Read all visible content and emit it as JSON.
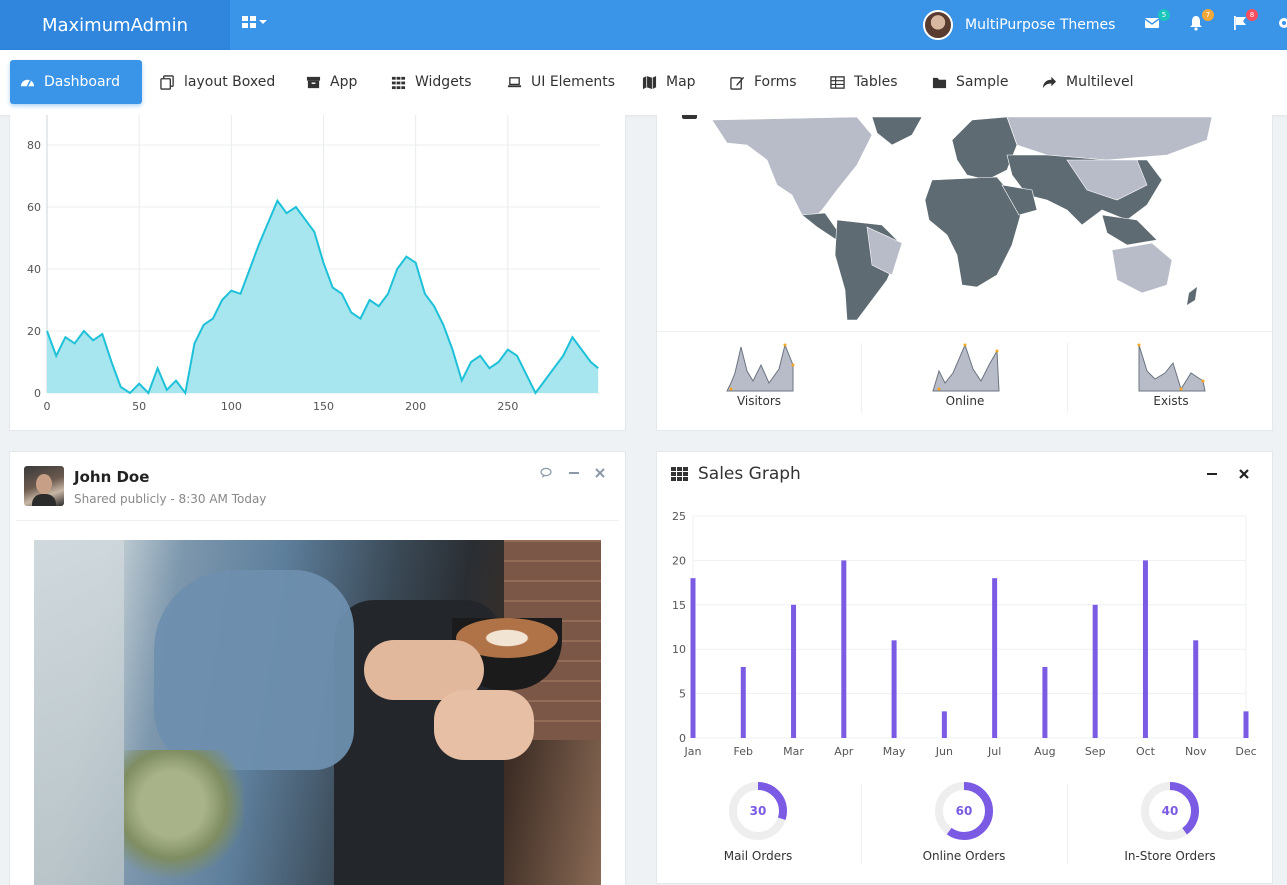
{
  "brand": "MaximumAdmin",
  "user": {
    "name": "MultiPurpose Themes"
  },
  "badges": {
    "mail": "5",
    "bell": "7",
    "flag": "8"
  },
  "colors": {
    "primary": "#3a94e8",
    "brand_bg": "#2f86dc",
    "area": "#1fc1d8",
    "area_fill": "#a8e6ef",
    "bar": "#7b5be4",
    "map_dark": "#5f6b73",
    "map_light": "#b8bcc9",
    "badge_mail": "#1bc5bd",
    "badge_bell": "#f2a93b",
    "badge_flag": "#f64e60"
  },
  "nav": [
    {
      "label": "Dashboard",
      "icon": "dashboard-icon"
    },
    {
      "label": "layout Boxed",
      "icon": "copy-icon"
    },
    {
      "label": "App",
      "icon": "archive-icon"
    },
    {
      "label": "Widgets",
      "icon": "grid-icon"
    },
    {
      "label": "UI Elements",
      "icon": "laptop-icon"
    },
    {
      "label": "Map",
      "icon": "map-icon"
    },
    {
      "label": "Forms",
      "icon": "edit-icon"
    },
    {
      "label": "Tables",
      "icon": "table-icon"
    },
    {
      "label": "Sample",
      "icon": "folder-icon"
    },
    {
      "label": "Multilevel",
      "icon": "share-icon"
    }
  ],
  "area_chart": {
    "x_ticks": [
      "0",
      "50",
      "100",
      "150",
      "200",
      "250"
    ],
    "y_ticks": [
      "0",
      "20",
      "40",
      "60",
      "80"
    ]
  },
  "map_stats": [
    {
      "label": "Visitors"
    },
    {
      "label": "Online"
    },
    {
      "label": "Exists"
    }
  ],
  "post": {
    "author": "John Doe",
    "meta": "Shared publicly - 8:30 AM Today"
  },
  "sales": {
    "title": "Sales Graph",
    "donuts": [
      {
        "value": "30",
        "label": "Mail Orders"
      },
      {
        "value": "60",
        "label": "Online Orders"
      },
      {
        "value": "40",
        "label": "In-Store Orders"
      }
    ]
  },
  "chart_data": [
    {
      "type": "area",
      "x": [
        0,
        5,
        10,
        15,
        20,
        25,
        30,
        35,
        40,
        45,
        50,
        55,
        60,
        65,
        70,
        75,
        80,
        85,
        90,
        95,
        100,
        105,
        110,
        115,
        120,
        125,
        130,
        135,
        140,
        145,
        150,
        155,
        160,
        165,
        170,
        175,
        180,
        185,
        190,
        195,
        200,
        205,
        210,
        215,
        220,
        225,
        230,
        235,
        240,
        245,
        250,
        255,
        260,
        265,
        270,
        275,
        280,
        285,
        290,
        295,
        299
      ],
      "y": [
        20,
        12,
        18,
        16,
        20,
        17,
        19,
        10,
        2,
        0,
        3,
        0,
        8,
        1,
        4,
        0,
        16,
        22,
        24,
        30,
        33,
        32,
        40,
        48,
        55,
        62,
        58,
        60,
        56,
        52,
        42,
        34,
        32,
        26,
        24,
        30,
        28,
        32,
        40,
        44,
        42,
        32,
        28,
        22,
        14,
        4,
        10,
        12,
        8,
        10,
        14,
        12,
        6,
        0,
        4,
        8,
        12,
        18,
        14,
        10,
        8
      ],
      "xlim": [
        0,
        300
      ],
      "ylim": [
        0,
        80
      ],
      "grid": true
    },
    {
      "type": "bar",
      "categories": [
        "Jan",
        "Feb",
        "Mar",
        "Apr",
        "May",
        "Jun",
        "Jul",
        "Aug",
        "Sep",
        "Oct",
        "Nov",
        "Dec"
      ],
      "values": [
        18,
        8,
        15,
        20,
        11,
        3,
        18,
        8,
        15,
        20,
        11,
        3
      ],
      "y_ticks": [
        "0",
        "5",
        "10",
        "15",
        "20",
        "25"
      ],
      "ylim": [
        0,
        25
      ],
      "grid": true
    }
  ]
}
